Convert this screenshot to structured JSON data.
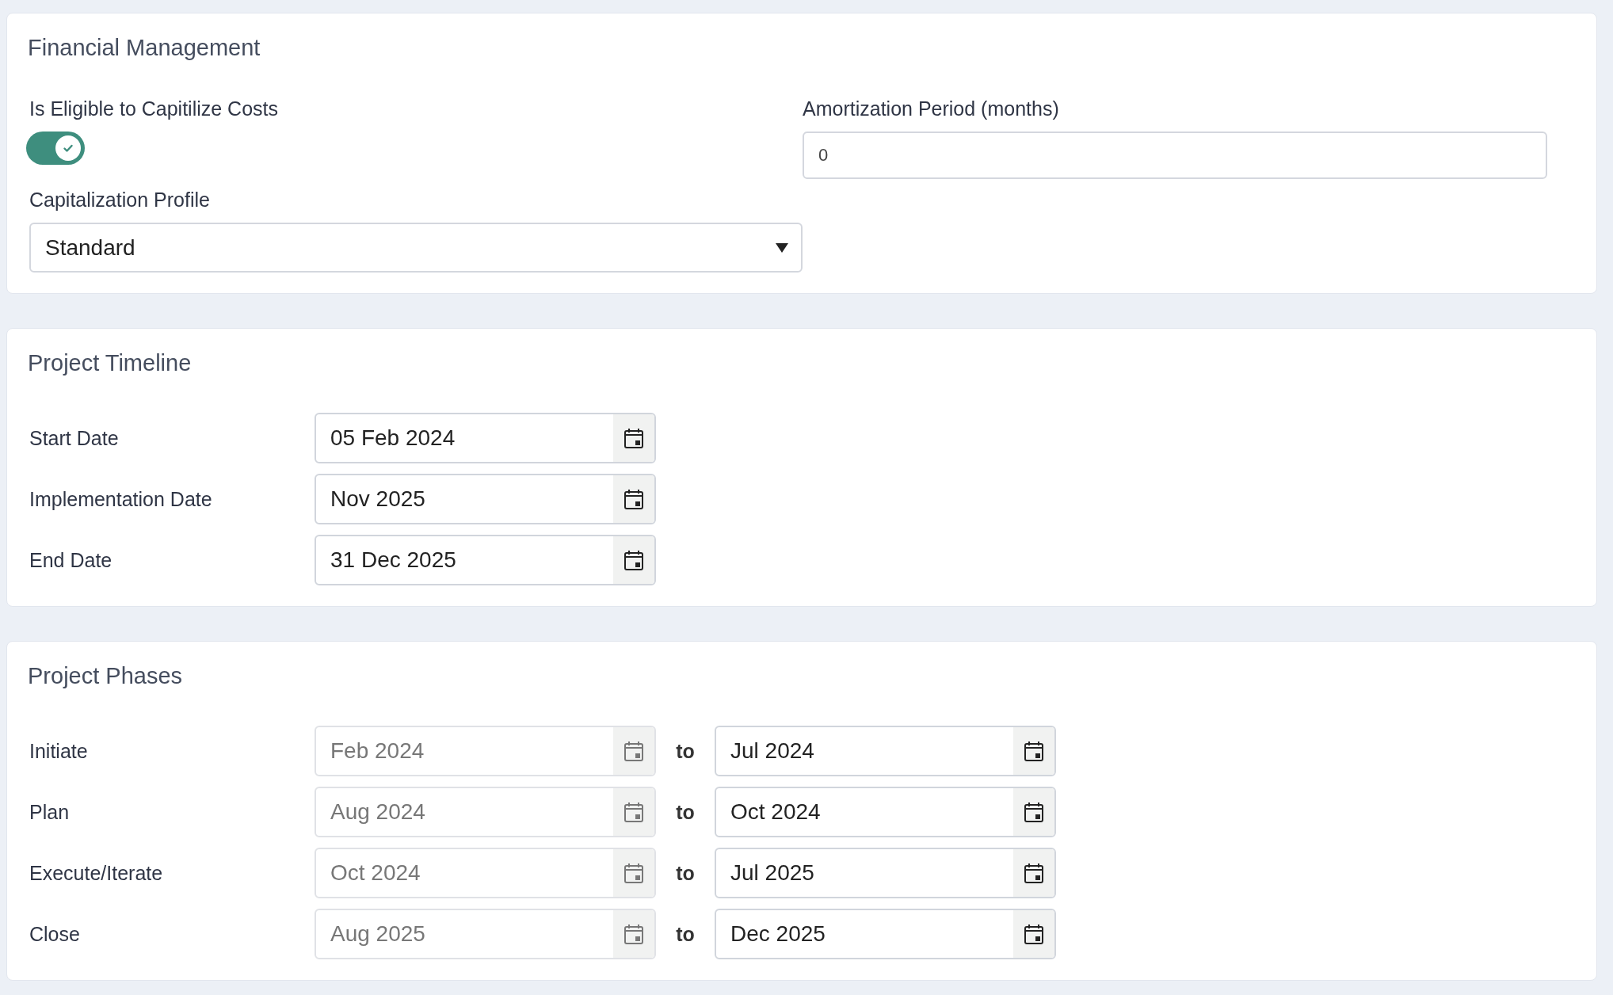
{
  "financial_management": {
    "title": "Financial Management",
    "capitalize": {
      "label": "Is Eligible to Capitilize Costs",
      "on": true
    },
    "amortization": {
      "label": "Amortization Period (months)",
      "value": "0"
    },
    "profile": {
      "label": "Capitalization Profile",
      "value": "Standard"
    }
  },
  "project_timeline": {
    "title": "Project Timeline",
    "dates": [
      {
        "label": "Start Date",
        "value": "05 Feb 2024",
        "disabled": false
      },
      {
        "label": "Implementation Date",
        "value": "Nov 2025",
        "disabled": false
      },
      {
        "label": "End Date",
        "value": "31 Dec 2025",
        "disabled": false
      }
    ]
  },
  "project_phases": {
    "title": "Project Phases",
    "phases": [
      {
        "label": "Initiate",
        "start": {
          "value": "Feb 2024",
          "disabled": true
        },
        "separator": "to",
        "end": {
          "value": "Jul 2024",
          "disabled": false
        }
      },
      {
        "label": "Plan",
        "start": {
          "value": "Aug 2024",
          "disabled": true
        },
        "separator": "to",
        "end": {
          "value": "Oct 2024",
          "disabled": false
        }
      },
      {
        "label": "Execute/Iterate",
        "start": {
          "value": "Oct 2024",
          "disabled": true
        },
        "separator": "to",
        "end": {
          "value": "Jul 2025",
          "disabled": false
        }
      },
      {
        "label": "Close",
        "start": {
          "value": "Aug 2025",
          "disabled": true
        },
        "separator": "to",
        "end": {
          "value": "Dec 2025",
          "disabled": false
        }
      }
    ]
  }
}
